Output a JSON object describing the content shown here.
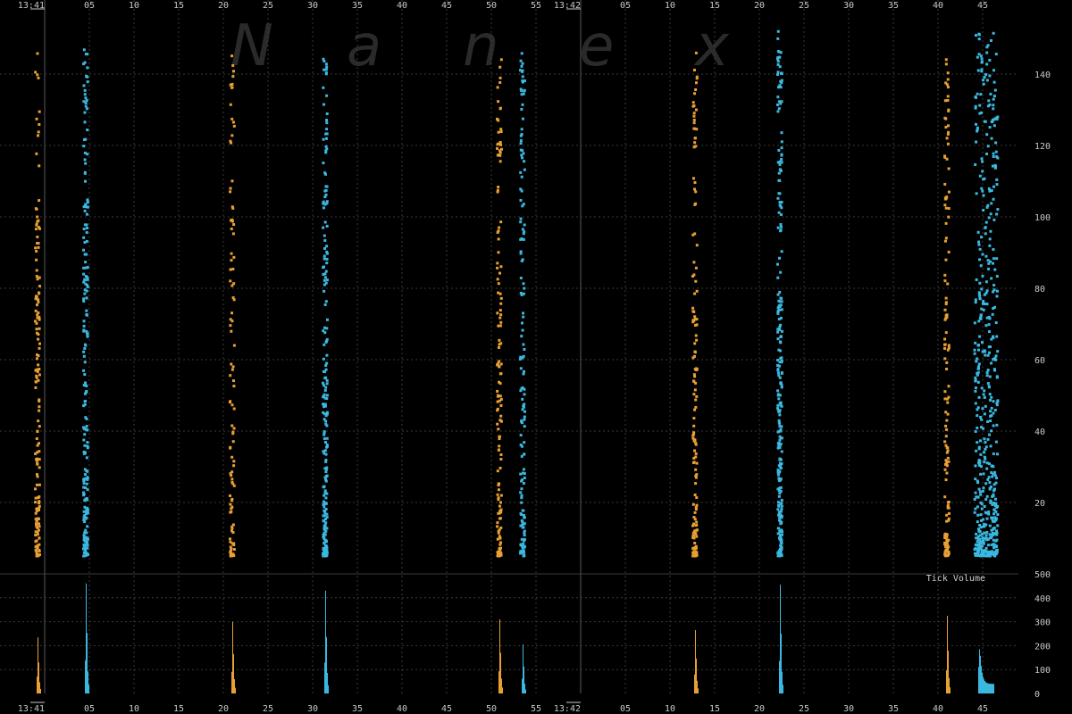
{
  "watermark": [
    "N",
    "a",
    "n",
    "e",
    "x"
  ],
  "colors": {
    "background": "#000000",
    "series_a": "#e8a033",
    "series_b": "#3ab8e0",
    "grid": "#3a3a3a",
    "minute_line": "#5a5a5a",
    "text": "#c8c8c8"
  },
  "chart_data": [
    {
      "type": "scatter",
      "title": "",
      "xlabel": "",
      "ylabel": "",
      "grid": true,
      "x_unit": "seconds from 13:41:00",
      "xlim": [
        -1.6,
        48.5
      ],
      "ylim": [
        0,
        150
      ],
      "y_ticks": [
        20,
        40,
        60,
        80,
        100,
        120,
        140
      ],
      "x_tick_labels": [
        {
          "t": 0,
          "label": "13:41"
        },
        {
          "t": 5,
          "label": "05"
        },
        {
          "t": 10,
          "label": "10"
        },
        {
          "t": 15,
          "label": "15"
        },
        {
          "t": 20,
          "label": "20"
        },
        {
          "t": 25,
          "label": "25"
        },
        {
          "t": 30,
          "label": "30"
        },
        {
          "t": 35,
          "label": "35"
        },
        {
          "t": 40,
          "label": "40"
        },
        {
          "t": 45,
          "label": "45"
        },
        {
          "t": 50,
          "label": "50"
        },
        {
          "t": 55,
          "label": "55"
        },
        {
          "t": 60,
          "label": "13:42"
        },
        {
          "t": 65,
          "label": "05"
        },
        {
          "t": 70,
          "label": "10"
        },
        {
          "t": 75,
          "label": "15"
        },
        {
          "t": 80,
          "label": "20"
        },
        {
          "t": 85,
          "label": "25"
        },
        {
          "t": 90,
          "label": "30"
        },
        {
          "t": 95,
          "label": "35"
        },
        {
          "t": 100,
          "label": "40"
        },
        {
          "t": 105,
          "label": "45"
        }
      ],
      "series": [
        {
          "color": "#e8a033",
          "bursts": [
            {
              "t": -0.8,
              "y_max": 147,
              "count": 150
            },
            {
              "t": 21.0,
              "y_max": 147,
              "count": 100
            },
            {
              "t": 50.9,
              "y_max": 147,
              "count": 140
            },
            {
              "t": 72.8,
              "y_max": 147,
              "count": 150
            },
            {
              "t": 101.0,
              "y_max": 147,
              "count": 140
            }
          ]
        },
        {
          "color": "#3ab8e0",
          "bursts": [
            {
              "t": 4.6,
              "y_max": 147,
              "count": 200
            },
            {
              "t": 31.4,
              "y_max": 147,
              "count": 220
            },
            {
              "t": 53.5,
              "y_max": 147,
              "count": 150
            },
            {
              "t": 82.3,
              "y_max": 152,
              "count": 260
            },
            {
              "t": 104.5,
              "y_max": 152,
              "count": 520
            }
          ]
        }
      ]
    },
    {
      "type": "bar",
      "title": "Tick Volume",
      "ylim": [
        0,
        500
      ],
      "y_ticks": [
        0,
        100,
        200,
        300,
        400,
        500
      ],
      "series": [
        {
          "color": "#e8a033",
          "spikes": [
            {
              "t": -0.8,
              "peak": 235
            },
            {
              "t": 21.0,
              "peak": 300
            },
            {
              "t": 50.9,
              "peak": 310
            },
            {
              "t": 72.8,
              "peak": 265
            },
            {
              "t": 101.0,
              "peak": 325
            }
          ]
        },
        {
          "color": "#3ab8e0",
          "spikes": [
            {
              "t": 4.6,
              "peak": 460
            },
            {
              "t": 31.4,
              "peak": 430
            },
            {
              "t": 53.5,
              "peak": 205
            },
            {
              "t": 82.3,
              "peak": 455
            },
            {
              "t": 104.5,
              "peak": 185
            }
          ]
        }
      ]
    }
  ]
}
